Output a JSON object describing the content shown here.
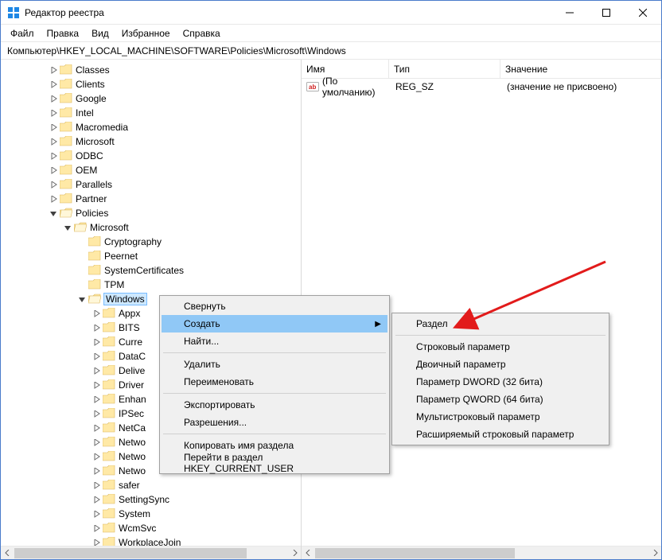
{
  "window": {
    "title": "Редактор реестра"
  },
  "menu": {
    "file": "Файл",
    "edit": "Правка",
    "view": "Вид",
    "favorites": "Избранное",
    "help": "Справка"
  },
  "address": {
    "label": "Компьютер\\HKEY_LOCAL_MACHINE\\SOFTWARE\\Policies\\Microsoft\\Windows"
  },
  "tree": {
    "level1": [
      "Classes",
      "Clients",
      "Google",
      "Intel",
      "Macromedia",
      "Microsoft",
      "ODBC",
      "OEM",
      "Parallels",
      "Partner",
      "Policies"
    ],
    "policies_children": {
      "microsoft": "Microsoft"
    },
    "microsoft_children": [
      "Cryptography",
      "Peernet",
      "SystemCertificates",
      "TPM",
      "Windows"
    ],
    "windows_children": [
      "Appx",
      "BITS",
      "Curre",
      "DataC",
      "Delive",
      "Driver",
      "Enhan",
      "IPSec",
      "NetCa",
      "Netwo",
      "Netwo",
      "Netwo",
      "safer",
      "SettingSync",
      "System",
      "WcmSvc",
      "WorkplaceJoin"
    ]
  },
  "values": {
    "cols": {
      "name": "Имя",
      "type": "Тип",
      "data": "Значение"
    },
    "row": {
      "name": "(По умолчанию)",
      "type": "REG_SZ",
      "data": "(значение не присвоено)"
    }
  },
  "ctx": {
    "collapse": "Свернуть",
    "new": "Создать",
    "find": "Найти...",
    "delete": "Удалить",
    "rename": "Переименовать",
    "export": "Экспортировать",
    "perms": "Разрешения...",
    "copyname": "Копировать имя раздела",
    "goto": "Перейти в раздел HKEY_CURRENT_USER"
  },
  "sub": {
    "key": "Раздел",
    "string": "Строковый параметр",
    "binary": "Двоичный параметр",
    "dword": "Параметр DWORD (32 бита)",
    "qword": "Параметр QWORD (64 бита)",
    "multi": "Мультистроковый параметр",
    "expand": "Расширяемый строковый параметр"
  }
}
